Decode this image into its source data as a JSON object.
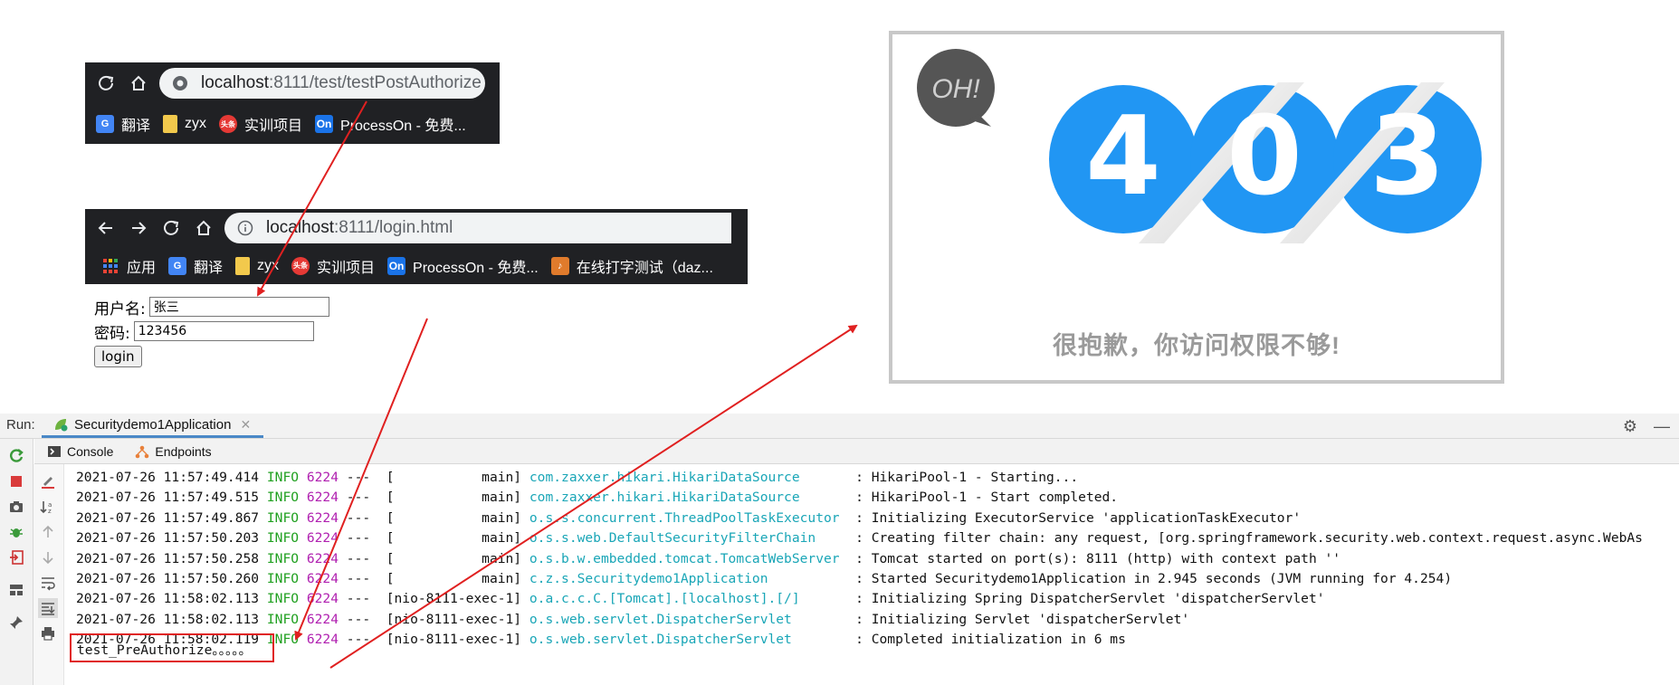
{
  "browser1": {
    "url_host": "localhost",
    "url_path": ":8111/test/testPostAuthorize",
    "bookmarks": [
      {
        "icon": "translate-icon",
        "label": "翻译"
      },
      {
        "icon": "folder-icon",
        "label": "zyx"
      },
      {
        "icon": "toutiao-icon",
        "label": "实训项目"
      },
      {
        "icon": "processon-icon",
        "label": "ProcessOn - 免费..."
      }
    ]
  },
  "browser2": {
    "url_host": "localhost",
    "url_path": ":8111/login.html",
    "bookmarks": [
      {
        "icon": "apps-icon",
        "label": "应用"
      },
      {
        "icon": "translate-icon",
        "label": "翻译"
      },
      {
        "icon": "folder-icon",
        "label": "zyx"
      },
      {
        "icon": "toutiao-icon",
        "label": "实训项目"
      },
      {
        "icon": "processon-icon",
        "label": "ProcessOn - 免费..."
      },
      {
        "icon": "typing-test-icon",
        "label": "在线打字测试（daz..."
      }
    ]
  },
  "login_form": {
    "username_label": "用户名:",
    "username_value": "张三",
    "password_label": "密码:",
    "password_value": "123456",
    "submit_label": "login"
  },
  "error_page": {
    "badge": "OH!",
    "digits": [
      "4",
      "0",
      "3"
    ],
    "message": "很抱歉，你访问权限不够!"
  },
  "ide": {
    "run_label": "Run:",
    "run_config": "Securitydemo1Application",
    "tabs": [
      "Console",
      "Endpoints"
    ],
    "log_lines": [
      {
        "ts": "2021-07-26 11:57:49.414",
        "level": "INFO",
        "pid": "6224",
        "thread": "---  [           main]",
        "logger": "com.zaxxer.hikari.HikariDataSource      ",
        "msg": ": HikariPool-1 - Starting..."
      },
      {
        "ts": "2021-07-26 11:57:49.515",
        "level": "INFO",
        "pid": "6224",
        "thread": "---  [           main]",
        "logger": "com.zaxxer.hikari.HikariDataSource      ",
        "msg": ": HikariPool-1 - Start completed."
      },
      {
        "ts": "2021-07-26 11:57:49.867",
        "level": "INFO",
        "pid": "6224",
        "thread": "---  [           main]",
        "logger": "o.s.s.concurrent.ThreadPoolTaskExecutor ",
        "msg": ": Initializing ExecutorService 'applicationTaskExecutor'"
      },
      {
        "ts": "2021-07-26 11:57:50.203",
        "level": "INFO",
        "pid": "6224",
        "thread": "---  [           main]",
        "logger": "o.s.s.web.DefaultSecurityFilterChain    ",
        "msg": ": Creating filter chain: any request, [org.springframework.security.web.context.request.async.WebAs"
      },
      {
        "ts": "2021-07-26 11:57:50.258",
        "level": "INFO",
        "pid": "6224",
        "thread": "---  [           main]",
        "logger": "o.s.b.w.embedded.tomcat.TomcatWebServer ",
        "msg": ": Tomcat started on port(s): 8111 (http) with context path ''"
      },
      {
        "ts": "2021-07-26 11:57:50.260",
        "level": "INFO",
        "pid": "6224",
        "thread": "---  [           main]",
        "logger": "c.z.s.Securitydemo1Application          ",
        "msg": ": Started Securitydemo1Application in 2.945 seconds (JVM running for 4.254)"
      },
      {
        "ts": "2021-07-26 11:58:02.113",
        "level": "INFO",
        "pid": "6224",
        "thread": "---  [nio-8111-exec-1]",
        "logger": "o.a.c.c.C.[Tomcat].[localhost].[/]      ",
        "msg": ": Initializing Spring DispatcherServlet 'dispatcherServlet'"
      },
      {
        "ts": "2021-07-26 11:58:02.113",
        "level": "INFO",
        "pid": "6224",
        "thread": "---  [nio-8111-exec-1]",
        "logger": "o.s.web.servlet.DispatcherServlet       ",
        "msg": ": Initializing Servlet 'dispatcherServlet'"
      },
      {
        "ts": "2021-07-26 11:58:02.119",
        "level": "INFO",
        "pid": "6224",
        "thread": "---  [nio-8111-exec-1]",
        "logger": "o.s.web.servlet.DispatcherServlet       ",
        "msg": ": Completed initialization in 6 ms"
      }
    ],
    "result_output": "test_PreAuthorize。。。。。"
  },
  "colors": {
    "arrow": "#e02020",
    "digit_blue": "#2196f3",
    "badge_gray": "#555555"
  }
}
